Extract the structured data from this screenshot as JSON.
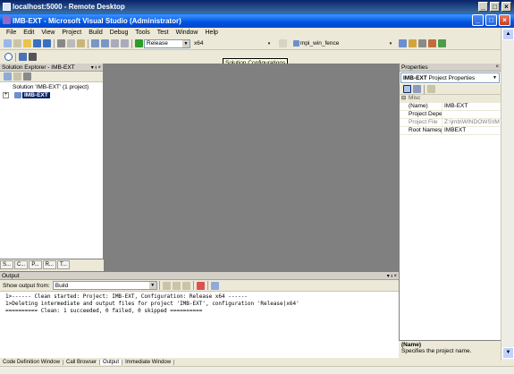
{
  "remote_desktop": {
    "title": "localhost:5000 - Remote Desktop"
  },
  "window": {
    "title": "IMB-EXT - Microsoft Visual Studio (Administrator)"
  },
  "menu": [
    "File",
    "Edit",
    "View",
    "Project",
    "Build",
    "Debug",
    "Tools",
    "Test",
    "Window",
    "Help"
  ],
  "toolbar": {
    "configuration": "Release",
    "platform": "x64",
    "find_value": "mpi_win_fence"
  },
  "tooltip": "Solution Configurations",
  "solution_explorer": {
    "title": "Solution Explorer - IMB-EXT",
    "solution_label": "Solution 'IMB-EXT' (1 project)",
    "project_label": "IMB-EXT",
    "tabs": [
      "S...",
      "C...",
      "P...",
      "R...",
      "T..."
    ]
  },
  "properties": {
    "title": "Properties",
    "object_name": "IMB-EXT",
    "object_type": "Project Properties",
    "category": "Misc",
    "rows": [
      {
        "key": "(Name)",
        "value": "IMB-EXT"
      },
      {
        "key": "Project Depende",
        "value": ""
      },
      {
        "key": "Project File",
        "value": "Z:\\jmb\\WINDOWS\\IM"
      },
      {
        "key": "Root Namespace",
        "value": "IMBEXT"
      }
    ],
    "desc_title": "(Name)",
    "desc_text": "Specifies the project name."
  },
  "output": {
    "title": "Output",
    "show_from_label": "Show output from:",
    "show_from_value": "Build",
    "lines": [
      "1>------ Clean started: Project: IMB-EXT, Configuration: Release x64 ------",
      "1>Deleting intermediate and output files for project 'IMB-EXT', configuration 'Release|x64'",
      "========== Clean: 1 succeeded, 0 failed, 0 skipped =========="
    ]
  },
  "bottom_tabs": [
    "Code Definition Window",
    "Call Browser",
    "Output",
    "Immediate Window"
  ]
}
